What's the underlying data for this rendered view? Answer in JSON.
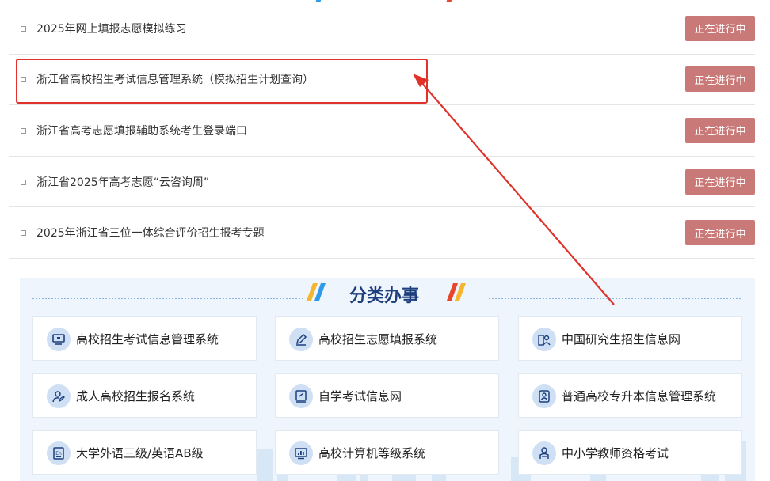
{
  "notices": [
    {
      "title": "2025年网上填报志愿模拟练习",
      "status": "正在进行中"
    },
    {
      "title": "浙江省高校招生考试信息管理系统（模拟招生计划查询）",
      "status": "正在进行中"
    },
    {
      "title": "浙江省高考志愿填报辅助系统考生登录端口",
      "status": "正在进行中"
    },
    {
      "title": "浙江省2025年高考志愿“云咨询周”",
      "status": "正在进行中"
    },
    {
      "title": "2025年浙江省三位一体综合评价招生报考专题",
      "status": "正在进行中"
    }
  ],
  "category": {
    "title": "分类办事",
    "items": [
      {
        "label": "高校招生考试信息管理系统",
        "icon": "monitor-icon"
      },
      {
        "label": "高校招生志愿填报系统",
        "icon": "pencil-icon"
      },
      {
        "label": "中国研究生招生信息网",
        "icon": "graduate-icon"
      },
      {
        "label": "成人高校招生报名系统",
        "icon": "user-edit-icon"
      },
      {
        "label": "自学考试信息网",
        "icon": "document-edit-icon"
      },
      {
        "label": "普通高校专升本信息管理系统",
        "icon": "id-card-icon"
      },
      {
        "label": "大学外语三级/英语AB级",
        "icon": "english-book-icon"
      },
      {
        "label": "高校计算机等级系统",
        "icon": "computer-chart-icon"
      },
      {
        "label": "中小学教师资格考试",
        "icon": "teacher-icon"
      }
    ]
  },
  "colors": {
    "badge": "#c97a78",
    "highlight": "#e0322a",
    "section_bg": "#eff5fc",
    "title": "#1e3f7d"
  }
}
